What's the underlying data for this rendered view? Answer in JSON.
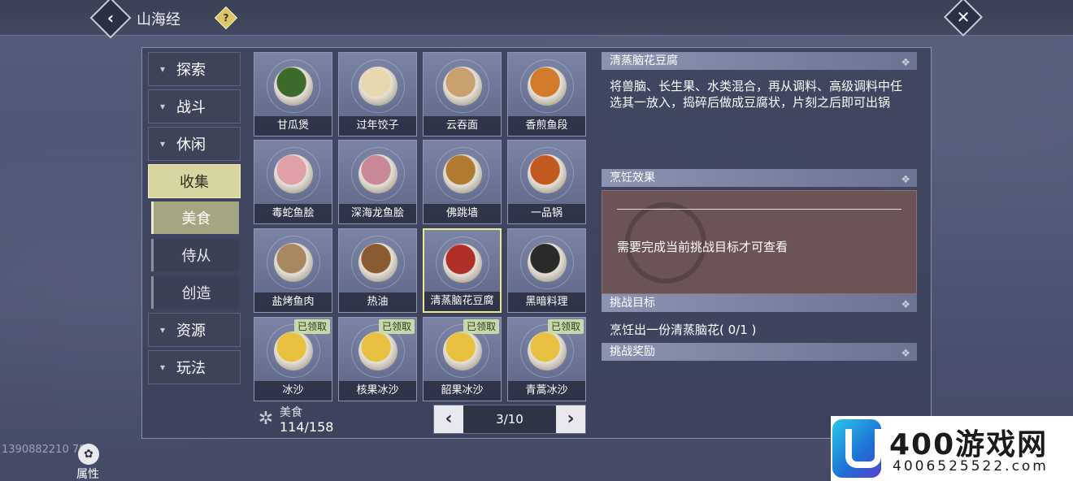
{
  "header": {
    "title": "山海经",
    "help": "?"
  },
  "sidebar": {
    "categories": [
      {
        "label": "探索"
      },
      {
        "label": "战斗"
      },
      {
        "label": "休闲"
      },
      {
        "label": "收集"
      },
      {
        "label": "资源"
      },
      {
        "label": "玩法"
      }
    ],
    "sub_items": [
      {
        "label": "美食"
      },
      {
        "label": "侍从"
      },
      {
        "label": "创造"
      }
    ]
  },
  "grid": {
    "items": [
      {
        "name": "甘瓜煲",
        "color": "#3d6a2a"
      },
      {
        "name": "过年饺子",
        "color": "#e8d8b0"
      },
      {
        "name": "云吞面",
        "color": "#c9a070"
      },
      {
        "name": "香煎鱼段",
        "color": "#d07a2a"
      },
      {
        "name": "毒蛇鱼脍",
        "color": "#e0a0a8"
      },
      {
        "name": "深海龙鱼脍",
        "color": "#c88898"
      },
      {
        "name": "佛跳墙",
        "color": "#b07a30"
      },
      {
        "name": "一品锅",
        "color": "#c05a20"
      },
      {
        "name": "盐烤鱼肉",
        "color": "#a88860"
      },
      {
        "name": "热油",
        "color": "#8a5a30"
      },
      {
        "name": "清蒸脑花豆腐",
        "color": "#b03028"
      },
      {
        "name": "黑暗料理",
        "color": "#2a2a2a"
      },
      {
        "name": "冰沙",
        "color": "#e8c040",
        "badge": "已领取"
      },
      {
        "name": "核果冰沙",
        "color": "#e8c040",
        "badge": "已领取"
      },
      {
        "name": "韶果冰沙",
        "color": "#e8c040",
        "badge": "已领取"
      },
      {
        "name": "青蒿冰沙",
        "color": "#e8c040",
        "badge": "已领取"
      }
    ],
    "category_label": "美食",
    "category_count": "114/158",
    "page": "3/10"
  },
  "detail": {
    "title": "清蒸脑花豆腐",
    "description": "将兽脑、长生果、水类混合，再从调料、高级调料中任选其一放入，捣碎后做成豆腐状，片刻之后即可出锅",
    "effect_header": "烹饪效果",
    "effect_locked": "需要完成当前挑战目标才可查看",
    "goal_header": "挑战目标",
    "goal_text": "烹饪出一份清蒸脑花( 0/1 )",
    "reward_header": "挑战奖励"
  },
  "footer": {
    "uid": "1390882210   789",
    "attr_label": "属性"
  },
  "watermark": {
    "brand": "400游戏网",
    "phone": "4006525522.com"
  }
}
